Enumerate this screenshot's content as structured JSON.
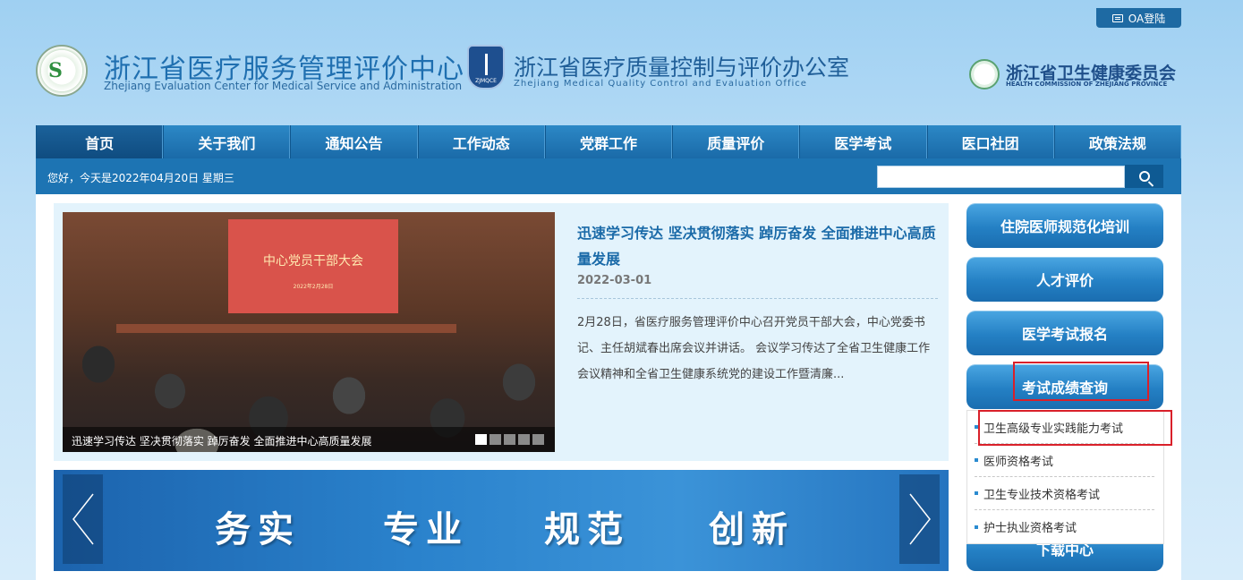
{
  "header": {
    "oa_login": "OA登陆",
    "logo1_cn": "浙江省医疗服务管理评价中心",
    "logo1_en": "Zhejiang Evaluation Center for Medical Service and Administration",
    "logo2_cn": "浙江省医疗质量控制与评价办公室",
    "logo2_en": "Zhejiang Medical Quality Control and Evaluation Office",
    "logo2_badge": "ZJMQCE",
    "logo3_cn": "浙江省卫生健康委员会",
    "logo3_en": "HEALTH COMMISSION OF ZHEJIANG PROVINCE"
  },
  "nav": {
    "items": [
      "首页",
      "关于我们",
      "通知公告",
      "工作动态",
      "党群工作",
      "质量评价",
      "医学考试",
      "医口社团",
      "政策法规"
    ]
  },
  "subbar": {
    "date_text": "您好，今天是2022年04月20日 星期三",
    "search_value": ""
  },
  "news": {
    "photo_banner": "中心党员干部大会",
    "photo_banner_sub": "2022年2月28日",
    "photo_caption": "迅速学习传达 坚决贯彻落实 踔厉奋发 全面推进中心高质量发展",
    "title": "迅速学习传达 坚决贯彻落实 踔厉奋发 全面推进中心高质量发展",
    "date": "2022-03-01",
    "summary": "2月28日，省医疗服务管理评价中心召开党员干部大会，中心党委书记、主任胡斌春出席会议并讲话。 会议学习传达了全省卫生健康工作会议精神和全省卫生健康系统党的建设工作暨清廉...",
    "slide_count": 5,
    "active_slide": 1
  },
  "slogan": {
    "words": [
      "务实",
      "专业",
      "规范",
      "创新"
    ]
  },
  "sidebar": {
    "buttons": [
      "住院医师规范化培训",
      "人才评价",
      "医学考试报名",
      "考试成绩查询",
      "下载中心"
    ],
    "dropdown": [
      "卫生高级专业实践能力考试",
      "医师资格考试",
      "卫生专业技术资格考试",
      "护士执业资格考试"
    ]
  },
  "colors": {
    "nav_bg": "#1a6aa8",
    "accent": "#1f6fb0",
    "highlight": "#d9202a"
  }
}
